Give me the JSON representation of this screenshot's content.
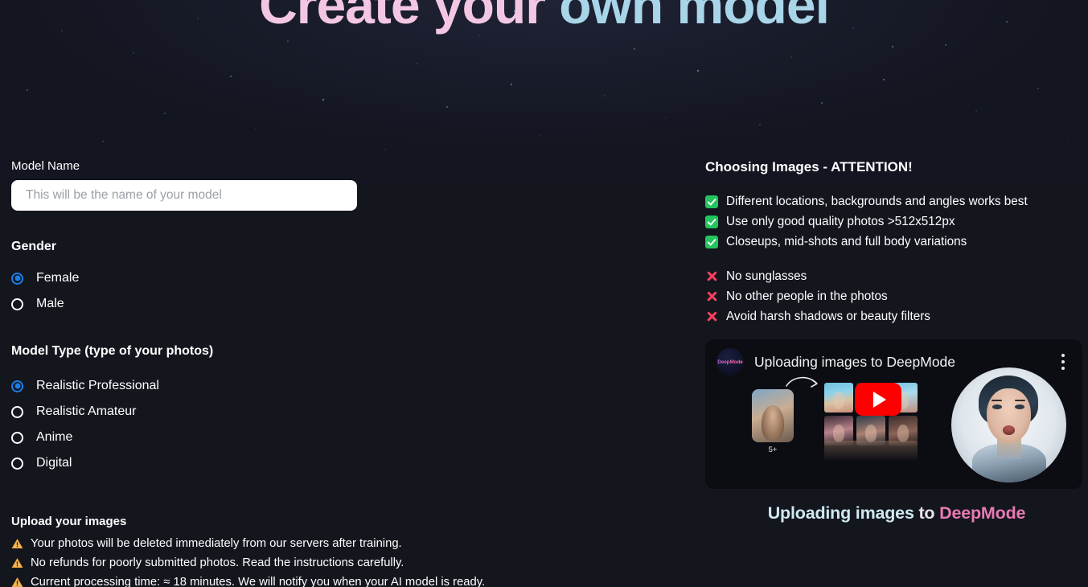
{
  "hero": {
    "title_part1": "Create your",
    "title_part2": " own model",
    "color_pink": "#f3c7e4",
    "color_blue": "#a9d5e8"
  },
  "form": {
    "model_name_label": "Model Name",
    "model_name_value": "",
    "model_name_placeholder": "This will be the name of your model",
    "gender_heading": "Gender",
    "gender_options": [
      {
        "label": "Female",
        "selected": true
      },
      {
        "label": "Male",
        "selected": false
      }
    ],
    "model_type_heading": "Model Type (type of your photos)",
    "model_type_options": [
      {
        "label": "Realistic Professional",
        "selected": true
      },
      {
        "label": "Realistic Amateur",
        "selected": false
      },
      {
        "label": "Anime",
        "selected": false
      },
      {
        "label": "Digital",
        "selected": false
      }
    ]
  },
  "upload": {
    "heading": "Upload your images",
    "warnings": [
      {
        "icon": "warning-icon",
        "text": "Your photos will be deleted immediately from our servers after training."
      },
      {
        "icon": "warning-icon",
        "text": "No refunds for poorly submitted photos. Read the instructions carefully."
      },
      {
        "icon": "warning-icon",
        "text": "Current processing time: ≈ 18 minutes. We will notify you when your AI model is ready."
      }
    ]
  },
  "tips": {
    "title": "Choosing Images - ATTENTION!",
    "do_items": [
      {
        "icon": "check-icon",
        "text": "Different locations, backgrounds and angles works best"
      },
      {
        "icon": "check-icon",
        "text": "Use only good quality photos >512x512px"
      },
      {
        "icon": "check-icon",
        "text": "Closeups, mid-shots and full body variations"
      }
    ],
    "dont_items": [
      {
        "icon": "cross-icon",
        "text": "No sunglasses"
      },
      {
        "icon": "cross-icon",
        "text": "No other people in the photos"
      },
      {
        "icon": "cross-icon",
        "text": "Avoid harsh shadows or beauty filters"
      }
    ],
    "check_color": "#22c55e",
    "cross_color": "#f43f5e"
  },
  "video": {
    "channel_name": "DeepMode",
    "title": "Uploading images to DeepMode",
    "menu_icon": "kebab-menu-icon",
    "play_icon": "youtube-play-icon",
    "play_color": "#ff0000",
    "photo_count_badge": "5+",
    "caption_part1": "Uploading images",
    "caption_part2": " to ",
    "caption_part3": "DeepMode"
  }
}
